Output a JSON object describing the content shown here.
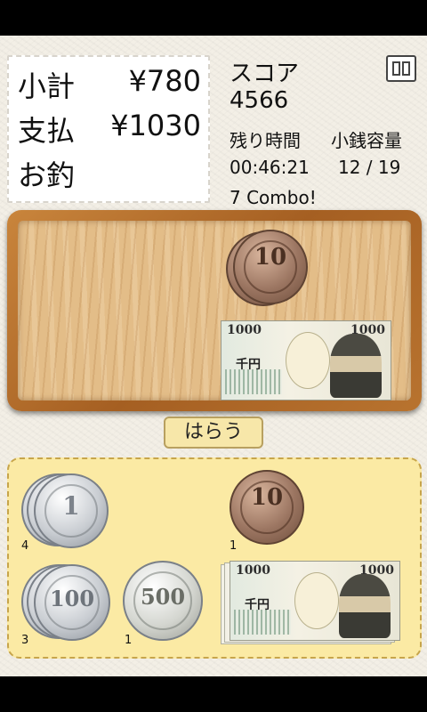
{
  "receipt": {
    "subtotal_label": "小計",
    "subtotal_value": "¥780",
    "payment_label": "支払",
    "payment_value": "¥1030",
    "change_label": "お釣",
    "change_value": ""
  },
  "hud": {
    "score_label": "スコア",
    "score_value": "4566",
    "time_label": "残り時間",
    "time_value": "00:46:21",
    "coin_capacity_label": "小銭容量",
    "coin_capacity_value": "12 / 19",
    "combo_text": "7 Combo!"
  },
  "pay_button_label": "はらう",
  "tray": {
    "coin_10_value": "10",
    "note_1000_value": "1000",
    "note_kanji": "千円"
  },
  "wallet": {
    "coin_1": {
      "value": "1",
      "count": "4"
    },
    "coin_10": {
      "value": "10",
      "count": "1"
    },
    "coin_100": {
      "value": "100",
      "count": "3"
    },
    "coin_500": {
      "value": "500",
      "count": "1"
    },
    "note_1000": {
      "value": "1000",
      "kanji": "千円"
    }
  },
  "colors": {
    "wood_frame": "#a55f22",
    "wood_surface": "#e3bd88",
    "wallet_bg": "#fbeaa4",
    "pay_button_bg": "#f7e7a9"
  }
}
